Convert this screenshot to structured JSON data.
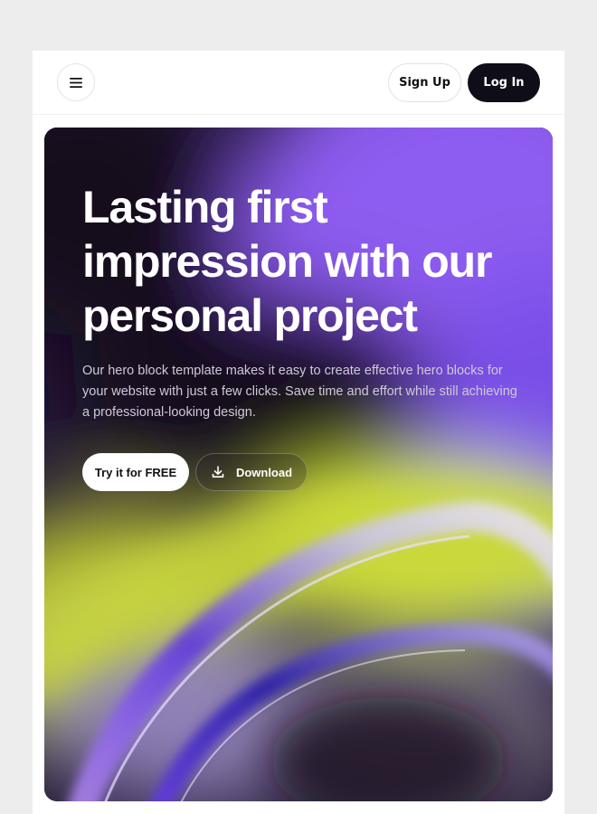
{
  "header": {
    "menu_icon": "hamburger-menu-icon",
    "signup_label": "Sign Up",
    "login_label": "Log In"
  },
  "hero": {
    "title": "Lasting first impression with our personal project",
    "description": "Our hero block template makes it easy to create effective hero blocks for your website with just a few clicks. Save time and effort while still achieving a professional-looking design.",
    "primary_cta": "Try it for FREE",
    "secondary_cta": "Download",
    "secondary_cta_icon": "download-icon"
  },
  "colors": {
    "page_background": "#ededed",
    "card_background": "#ffffff",
    "login_button": "#0f0d17",
    "hero_purple": "#8b5cf0",
    "hero_lime": "#d7e83a",
    "hero_dark": "#161320"
  }
}
